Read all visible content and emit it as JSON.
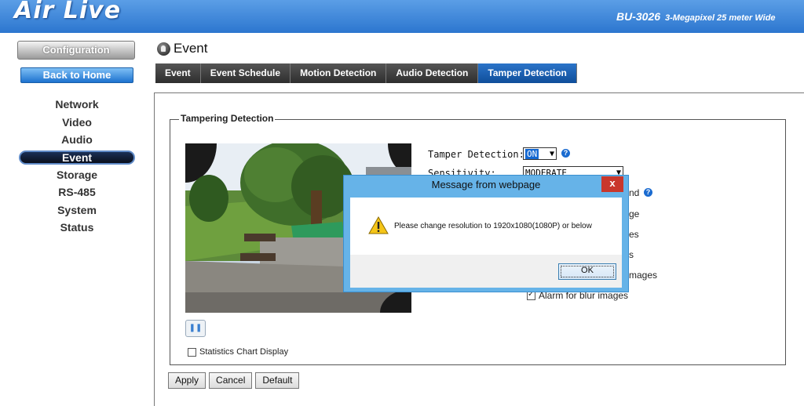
{
  "header": {
    "logo": "Air Live",
    "model": "BU-3026",
    "description": "3-Megapixel 25 meter Wide"
  },
  "sidebar": {
    "configuration_label": "Configuration",
    "back_home_label": "Back to Home",
    "items": [
      {
        "label": "Network"
      },
      {
        "label": "Video"
      },
      {
        "label": "Audio"
      },
      {
        "label": "Event"
      },
      {
        "label": "Storage"
      },
      {
        "label": "RS-485"
      },
      {
        "label": "System"
      },
      {
        "label": "Status"
      }
    ],
    "active_item": "Event"
  },
  "page": {
    "title": "Event",
    "tabs": [
      {
        "label": "Event"
      },
      {
        "label": "Event Schedule"
      },
      {
        "label": "Motion Detection"
      },
      {
        "label": "Audio Detection"
      },
      {
        "label": "Tamper Detection"
      }
    ],
    "active_tab": "Tamper Detection"
  },
  "tamper": {
    "section_title": "Tampering Detection",
    "tamper_label": "Tamper Detection:",
    "tamper_value": "ON",
    "sensitivity_label": "Sensitivity:",
    "sensitivity_value": "MODERATE",
    "option_fragments": [
      "nd",
      "ge",
      "es",
      "s",
      "mages"
    ],
    "blur_option": "Alarm for blur images",
    "statistics_label": "Statistics Chart Display",
    "pause_icon": "pause-icon"
  },
  "buttons": {
    "apply": "Apply",
    "cancel": "Cancel",
    "default": "Default"
  },
  "dialog": {
    "title": "Message from webpage",
    "close": "x",
    "message": "Please change resolution to 1920x1080(1080P) or below",
    "ok": "OK"
  },
  "colors": {
    "header_blue": "#2c76cf",
    "active_tab_blue": "#1562b8",
    "dialog_frame": "#66b3e8",
    "close_red": "#c9372c"
  }
}
